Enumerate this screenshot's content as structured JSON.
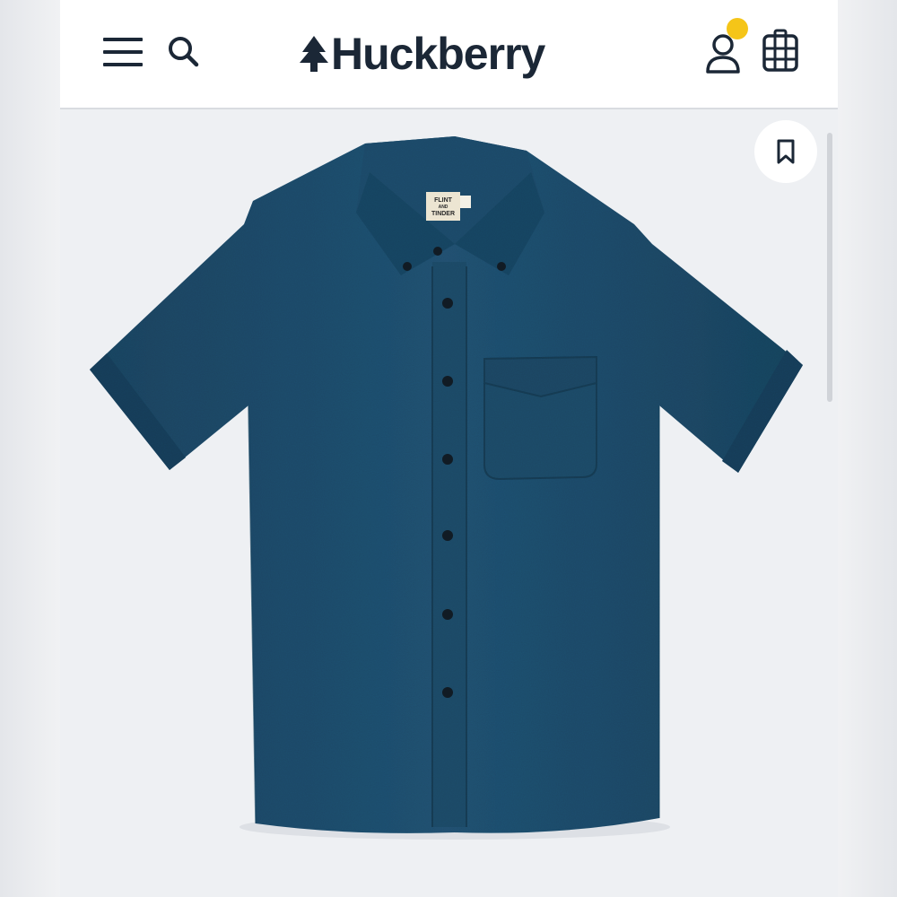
{
  "header": {
    "brand": "Huckberry",
    "icons": {
      "menu": "hamburger-menu-icon",
      "search": "search-icon",
      "logo": "tree-icon",
      "account": "user-icon",
      "cart": "backpack-icon"
    },
    "notification_color": "#f5c518"
  },
  "product": {
    "image_alt": "Short sleeve button-down shirt in navy blue",
    "shirt_color": "#23506f",
    "label": {
      "line1": "FLINT",
      "line2": "AND",
      "line3": "TINDER"
    },
    "bookmark_icon": "bookmark-icon"
  },
  "colors": {
    "brand_dark": "#1b2736",
    "background": "#eef0f3"
  }
}
